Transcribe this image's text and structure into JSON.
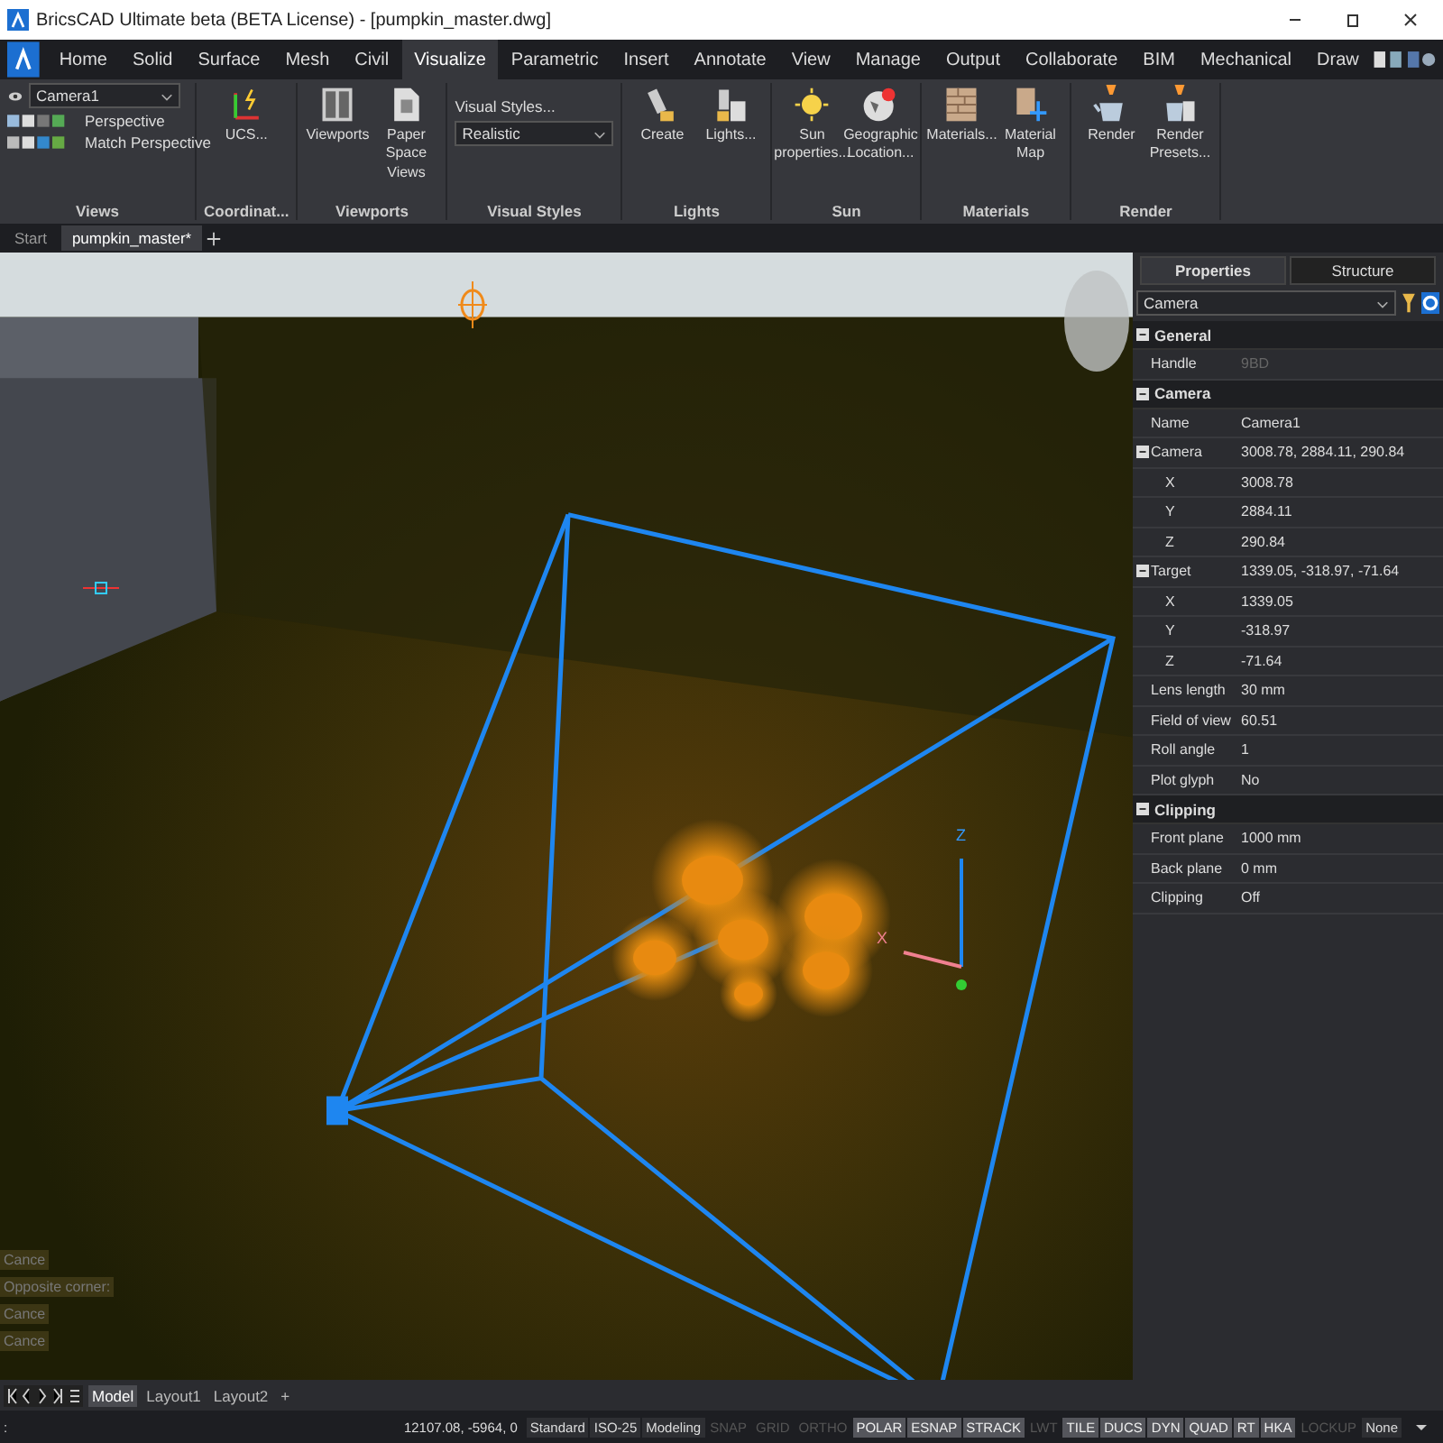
{
  "window": {
    "title": "BricsCAD Ultimate beta (BETA License) - [pumpkin_master.dwg]"
  },
  "ribbon_tabs": [
    {
      "label": "Home",
      "selected": false
    },
    {
      "label": "Solid",
      "selected": false
    },
    {
      "label": "Surface",
      "selected": false
    },
    {
      "label": "Mesh",
      "selected": false
    },
    {
      "label": "Civil",
      "selected": false
    },
    {
      "label": "Visualize",
      "selected": true
    },
    {
      "label": "Parametric",
      "selected": false
    },
    {
      "label": "Insert",
      "selected": false
    },
    {
      "label": "Annotate",
      "selected": false
    },
    {
      "label": "View",
      "selected": false
    },
    {
      "label": "Manage",
      "selected": false
    },
    {
      "label": "Output",
      "selected": false
    },
    {
      "label": "Collaborate",
      "selected": false
    },
    {
      "label": "BIM",
      "selected": false
    },
    {
      "label": "Mechanical",
      "selected": false
    },
    {
      "label": "Draw",
      "selected": false
    }
  ],
  "views_panel": {
    "camera_select": "Camera1",
    "perspective": "Perspective",
    "match_perspective": "Match Perspective",
    "label": "Views"
  },
  "ribbon_groups": [
    {
      "label": "Coordinat...",
      "buttons": [
        {
          "label": "UCS...",
          "kind": "ucs"
        }
      ]
    },
    {
      "label": "Viewports",
      "buttons": [
        {
          "label": "Viewports",
          "kind": "viewport"
        },
        {
          "label": "Paper Space Views",
          "kind": "page"
        }
      ]
    },
    {
      "label": "Visual Styles",
      "kind": "styles",
      "link": "Visual Styles...",
      "select": "Realistic"
    },
    {
      "label": "Lights",
      "buttons": [
        {
          "label": "Create",
          "kind": "light"
        },
        {
          "label": "Lights...",
          "kind": "lights"
        }
      ]
    },
    {
      "label": "Sun",
      "buttons": [
        {
          "label": "Sun properties...",
          "kind": "sun"
        },
        {
          "label": "Geographic Location...",
          "kind": "globe"
        }
      ]
    },
    {
      "label": "Materials",
      "buttons": [
        {
          "label": "Materials...",
          "kind": "brick"
        },
        {
          "label": "Material Map",
          "kind": "map"
        }
      ]
    },
    {
      "label": "Render",
      "buttons": [
        {
          "label": "Render",
          "kind": "teapot"
        },
        {
          "label": "Render Presets...",
          "kind": "preset"
        }
      ]
    }
  ],
  "doc_tabs": [
    {
      "label": "Start",
      "selected": false
    },
    {
      "label": "pumpkin_master*",
      "selected": true
    }
  ],
  "command_history": [
    "Cance",
    "Opposite corner:",
    "Cance",
    "Cance"
  ],
  "axis_labels": {
    "x": "X",
    "z": "Z"
  },
  "properties": {
    "tabs": [
      {
        "label": "Properties",
        "selected": true
      },
      {
        "label": "Structure",
        "selected": false
      }
    ],
    "selector": "Camera",
    "sections": [
      {
        "title": "General",
        "expanded": true,
        "rows": [
          {
            "name": "Handle",
            "value": "9BD",
            "disabled": true
          }
        ]
      },
      {
        "title": "Camera",
        "expanded": true,
        "rows": [
          {
            "name": "Name",
            "value": "Camera1",
            "disabled": false
          },
          {
            "name": "Camera",
            "value": "3008.78, 2884.11, 290.84",
            "disabled": false,
            "expanded": true,
            "children": [
              {
                "name": "X",
                "value": "3008.78"
              },
              {
                "name": "Y",
                "value": "2884.11"
              },
              {
                "name": "Z",
                "value": "290.84"
              }
            ]
          },
          {
            "name": "Target",
            "value": "1339.05, -318.97, -71.64",
            "disabled": false,
            "expanded": true,
            "children": [
              {
                "name": "X",
                "value": "1339.05"
              },
              {
                "name": "Y",
                "value": "-318.97"
              },
              {
                "name": "Z",
                "value": "-71.64"
              }
            ]
          },
          {
            "name": "Lens length",
            "value": "30 mm",
            "disabled": false
          },
          {
            "name": "Field of view",
            "value": "60.51",
            "disabled": false
          },
          {
            "name": "Roll angle",
            "value": "1",
            "disabled": false
          },
          {
            "name": "Plot glyph",
            "value": "No",
            "disabled": false
          }
        ]
      },
      {
        "title": "Clipping",
        "expanded": true,
        "rows": [
          {
            "name": "Front plane",
            "value": "1000 mm",
            "disabled": false
          },
          {
            "name": "Back plane",
            "value": "0 mm",
            "disabled": false
          },
          {
            "name": "Clipping",
            "value": "Off",
            "disabled": false
          }
        ]
      }
    ]
  },
  "layout_tabs": [
    {
      "label": "Model",
      "selected": true
    },
    {
      "label": "Layout1",
      "selected": false
    },
    {
      "label": "Layout2",
      "selected": false
    }
  ],
  "add_layout": "+",
  "status_bar": {
    "prompt": ":",
    "coordinates": "12107.08, -5964, 0",
    "fields": [
      "Standard",
      "ISO-25",
      "Modeling"
    ],
    "toggles": [
      {
        "label": "SNAP",
        "on": false
      },
      {
        "label": "GRID",
        "on": false
      },
      {
        "label": "ORTHO",
        "on": false
      },
      {
        "label": "POLAR",
        "on": true
      },
      {
        "label": "ESNAP",
        "on": true
      },
      {
        "label": "STRACK",
        "on": true
      },
      {
        "label": "LWT",
        "on": false
      },
      {
        "label": "TILE",
        "on": true
      },
      {
        "label": "DUCS",
        "on": true
      },
      {
        "label": "DYN",
        "on": true
      },
      {
        "label": "QUAD",
        "on": true
      },
      {
        "label": "RT",
        "on": true
      },
      {
        "label": "HKA",
        "on": true
      },
      {
        "label": "LOCKUP",
        "on": false
      }
    ],
    "annotation": "None"
  }
}
